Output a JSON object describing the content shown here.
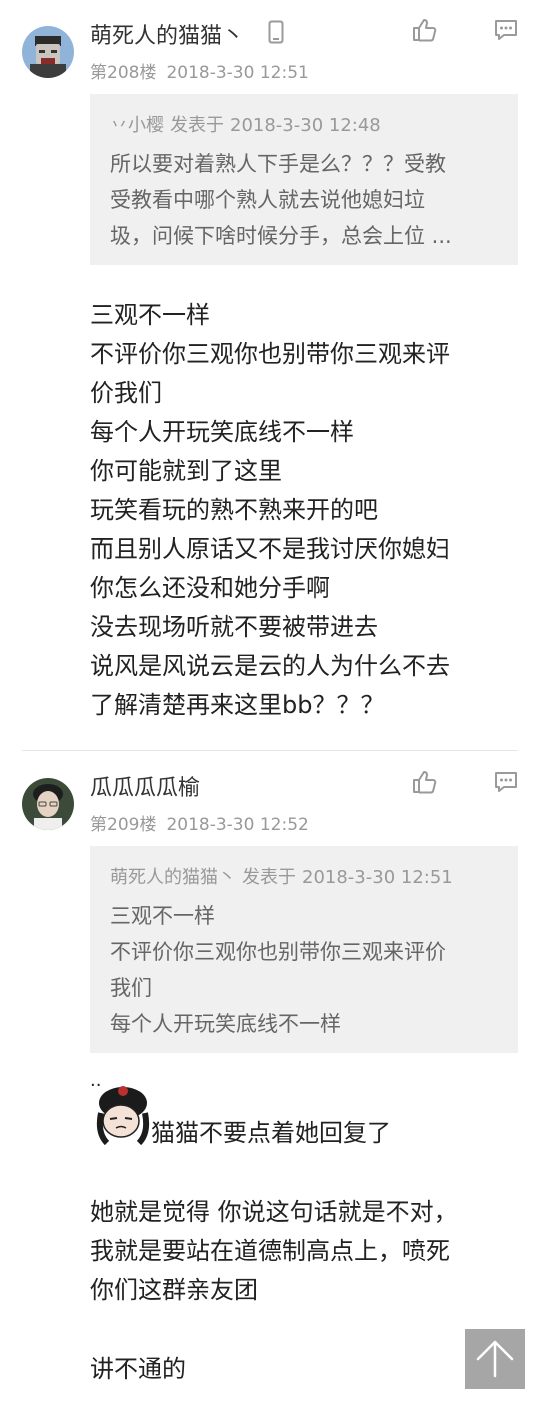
{
  "posts": [
    {
      "username": "萌死人的猫猫丶",
      "floor": "第208楼",
      "time": "2018-3-30 12:51",
      "quote": {
        "author": "丷小樱",
        "verb": "发表于",
        "time": "2018-3-30 12:48",
        "lines": [
          "所以要对着熟人下手是么？？？受教",
          "受教看中哪个熟人就去说他媳妇垃",
          "圾，问候下啥时候分手，总会上位 ..."
        ]
      },
      "body": [
        "三观不一样",
        "不评价你三观你也别带你三观来评",
        "价我们",
        "每个人开玩笑底线不一样",
        "你可能就到了这里",
        "玩笑看玩的熟不熟来开的吧",
        "而且别人原话又不是我讨厌你媳妇",
        "你怎么还没和她分手啊",
        "没去现场听就不要被带进去",
        "说风是风说云是云的人为什么不去",
        "了解清楚再来这里bb？？？"
      ]
    },
    {
      "username": "瓜瓜瓜瓜榆",
      "floor": "第209楼",
      "time": "2018-3-30 12:52",
      "quote": {
        "author": "萌死人的猫猫丶",
        "verb": "发表于",
        "time": "2018-3-30 12:51",
        "lines": [
          "三观不一样",
          "不评价你三观你也别带你三观来评价",
          "我们",
          "每个人开玩笑底线不一样"
        ]
      },
      "dots": "..",
      "sticker_line": "猫猫不要点着她回复了",
      "body": [
        "她就是觉得 你说这句话就是不对，",
        "我就是要站在道德制高点上，喷死",
        "你们这群亲友团"
      ],
      "body_tail": "讲不通的"
    }
  ],
  "icons": {
    "like": "thumbs-up-icon",
    "reply": "comment-icon",
    "device": "phone-icon",
    "scroll_top": "arrow-up-icon"
  },
  "colors": {
    "quote_bg": "#f0f0f0",
    "meta_text": "#999999",
    "scroll_button": "#a6a6a6"
  }
}
